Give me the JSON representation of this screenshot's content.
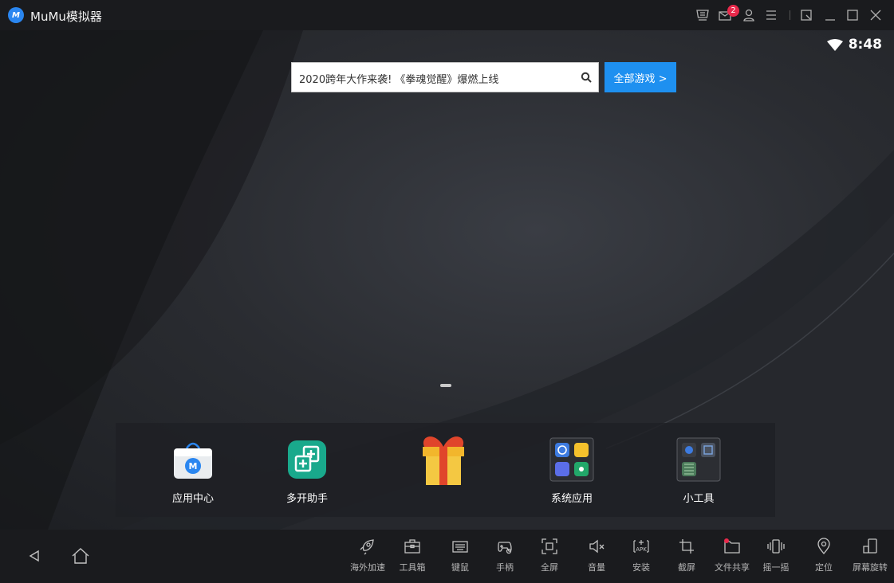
{
  "window": {
    "title": "MuMu模拟器",
    "logo_text": "M",
    "message_badge_count": "2",
    "controls": [
      "shop-icon",
      "message-icon",
      "user-icon",
      "menu-icon",
      "mini-mode-icon",
      "minimize-icon",
      "maximize-icon",
      "close-icon"
    ]
  },
  "status_bar": {
    "time": "8:48",
    "wifi": "wifi-icon"
  },
  "search": {
    "text": "2020跨年大作来袭! 《拳魂觉醒》爆燃上线",
    "button_label": "全部游戏 >"
  },
  "dock": {
    "items": [
      {
        "label": "应用中心",
        "icon": "app-center-icon"
      },
      {
        "label": "多开助手",
        "icon": "multi-instance-icon"
      },
      {
        "label": "",
        "icon": "gift-icon"
      },
      {
        "label": "系统应用",
        "icon": "system-apps-folder-icon"
      },
      {
        "label": "小工具",
        "icon": "tools-folder-icon"
      }
    ]
  },
  "toolbar": {
    "nav": [
      "back-icon",
      "home-icon"
    ],
    "tools": [
      {
        "label": "海外加速",
        "icon": "rocket-icon"
      },
      {
        "label": "工具箱",
        "icon": "toolbox-icon"
      },
      {
        "label": "键鼠",
        "icon": "keyboard-icon"
      },
      {
        "label": "手柄",
        "icon": "gamepad-icon"
      },
      {
        "label": "全屏",
        "icon": "fullscreen-icon"
      },
      {
        "label": "音量",
        "icon": "volume-mute-icon"
      },
      {
        "label": "安装",
        "icon": "apk-install-icon"
      },
      {
        "label": "截屏",
        "icon": "screenshot-crop-icon"
      },
      {
        "label": "文件共享",
        "icon": "folder-share-icon"
      },
      {
        "label": "摇一摇",
        "icon": "shake-icon"
      },
      {
        "label": "定位",
        "icon": "location-icon"
      },
      {
        "label": "屏幕旋转",
        "icon": "rotate-screen-icon"
      }
    ]
  },
  "colors": {
    "accent": "#1e90f0",
    "badge": "#e8294b",
    "titlebar": "#1a1b1e"
  }
}
